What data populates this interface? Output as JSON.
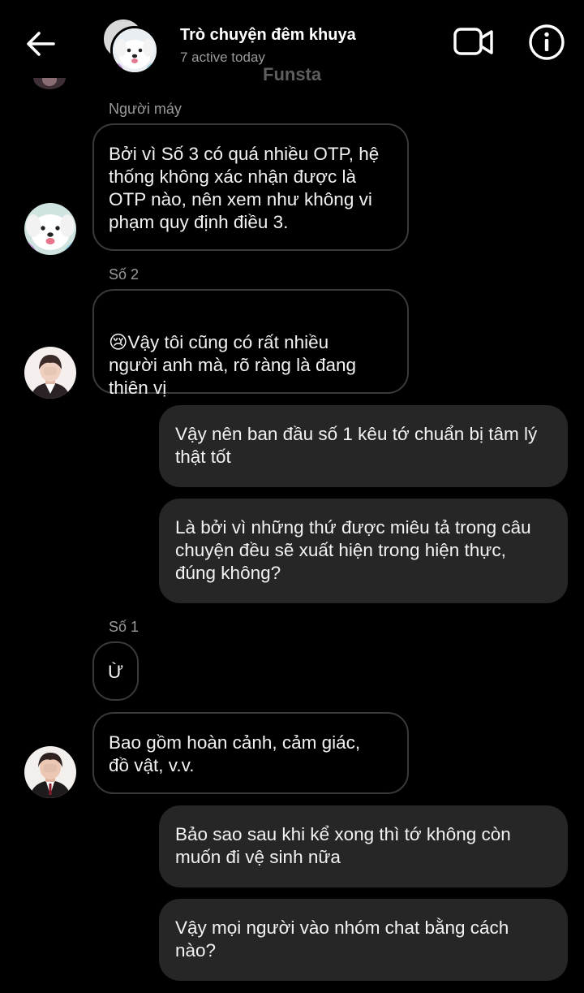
{
  "header": {
    "title": "Trò chuyện đêm khuya",
    "subtitle": "7 active today",
    "watermark": "Funsta",
    "back_icon": "arrow-left-icon",
    "video_icon": "video-camera-icon",
    "info_icon": "info-circle-icon"
  },
  "messages": [
    {
      "sender": "Người máy",
      "direction": "incoming",
      "text": "Bởi vì Số 3 có quá nhiều OTP, hệ\nthống không xác nhận được là\nOTP nào, nên xem như không vi\nphạm quy định điều 3."
    },
    {
      "sender": "Số 2",
      "direction": "incoming",
      "emoji": "😢",
      "text": "Vậy tôi cũng có rất nhiều\nngười anh mà, rõ ràng là đang\nthiên vị"
    },
    {
      "direction": "outgoing",
      "text": "Vậy nên ban đầu số 1 kêu tớ chuẩn bị tâm lý\nthật tốt"
    },
    {
      "direction": "outgoing",
      "text": "Là bởi vì những thứ được miêu tả trong câu\nchuyện đều sẽ xuất hiện trong hiện thực,\nđúng không?"
    },
    {
      "sender": "Số 1",
      "direction": "incoming",
      "text": "Ừ"
    },
    {
      "direction": "incoming",
      "text": "Bao gồm hoàn cảnh, cảm giác,\nđồ vật, v.v."
    },
    {
      "direction": "outgoing",
      "text": "Bảo sao sau khi kể xong thì tớ không còn\nmuốn đi vệ sinh nữa"
    },
    {
      "direction": "outgoing",
      "text": "Vậy mọi người vào nhóm chat bằng cách\nnào?"
    }
  ],
  "colors": {
    "background": "#000000",
    "outgoing_bubble": "#262626",
    "incoming_border": "#3a3a3a",
    "secondary_text": "#9a9a9a"
  }
}
